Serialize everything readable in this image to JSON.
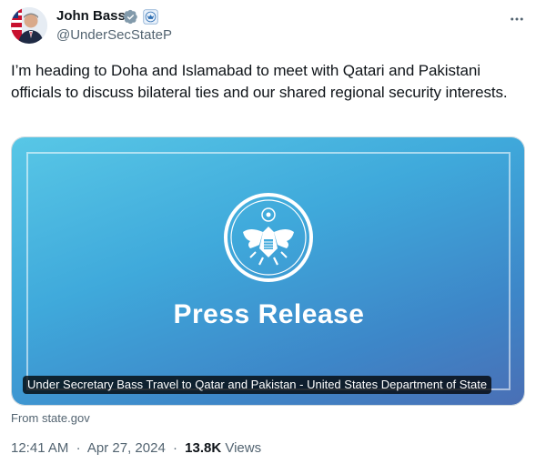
{
  "author": {
    "name": "John Bass",
    "handle": "@UnderSecStateP",
    "avatar_icon": "avatar-photo",
    "verified_color": "#829aab"
  },
  "tweet": {
    "text": "I’m heading to Doha and Islamabad to meet with Qatari and Pakistani officials to discuss bilateral ties and our shared regional security interests."
  },
  "card": {
    "headline": "Press Release",
    "caption": "Under Secretary Bass Travel to Qatar and Pakistan - United States Department of State",
    "source": "From state.gov",
    "gradient_start": "#58c7e6",
    "gradient_end": "#4a6fb5"
  },
  "meta": {
    "time": "12:41 AM",
    "date": "Apr 27, 2024",
    "separator": "·",
    "views_count": "13.8K",
    "views_label": "Views"
  }
}
